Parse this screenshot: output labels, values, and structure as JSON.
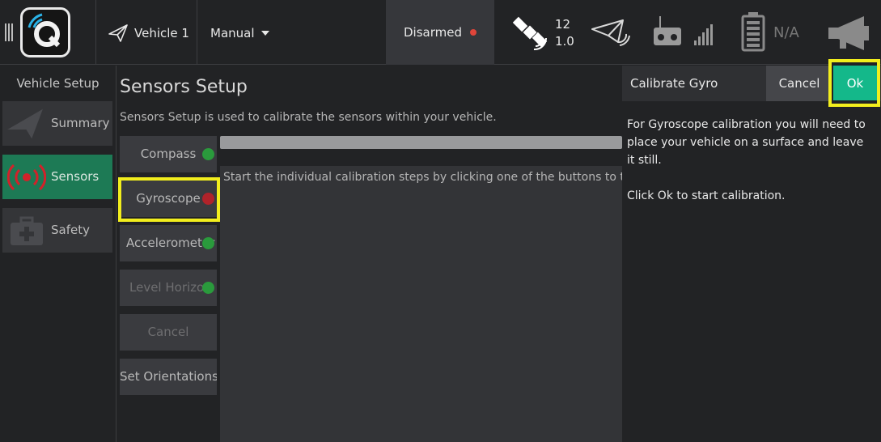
{
  "toolbar": {
    "vehicle_label": "Vehicle 1",
    "mode_label": "Manual",
    "armed_status": "Disarmed",
    "gps_count": "12",
    "gps_hdop": "1.0",
    "battery_text": "N/A"
  },
  "left_panel": {
    "title": "Vehicle Setup",
    "items": [
      {
        "label": "Summary",
        "icon": "paper-plane-icon",
        "active": false
      },
      {
        "label": "Sensors",
        "icon": "radio-signal-icon",
        "active": true
      },
      {
        "label": "Safety",
        "icon": "first-aid-kit-icon",
        "active": false
      }
    ]
  },
  "main": {
    "title": "Sensors Setup",
    "description": "Sensors Setup is used to calibrate the sensors within your vehicle.",
    "buttons": [
      {
        "label": "Compass",
        "status": "green"
      },
      {
        "label": "Gyroscope",
        "status": "red"
      },
      {
        "label": "Accelerometer",
        "status": "green"
      },
      {
        "label": "Level Horizon",
        "status": "green"
      },
      {
        "label": "Cancel",
        "status": ""
      },
      {
        "label": "Set Orientations",
        "status": ""
      }
    ],
    "status_text": "Start the individual calibration steps by clicking one of the buttons to the left."
  },
  "dialog": {
    "title": "Calibrate Gyro",
    "cancel_label": "Cancel",
    "ok_label": "Ok",
    "body_line1": "For Gyroscope calibration you will need to place your vehicle on a surface and leave it still.",
    "body_line2": "Click Ok to start calibration."
  },
  "colors": {
    "accent_green": "#14b88a",
    "active_nav": "#1d7a55",
    "highlight_yellow": "#f2ee1d",
    "status_red": "#b0232a",
    "status_green": "#2a9a3c"
  }
}
